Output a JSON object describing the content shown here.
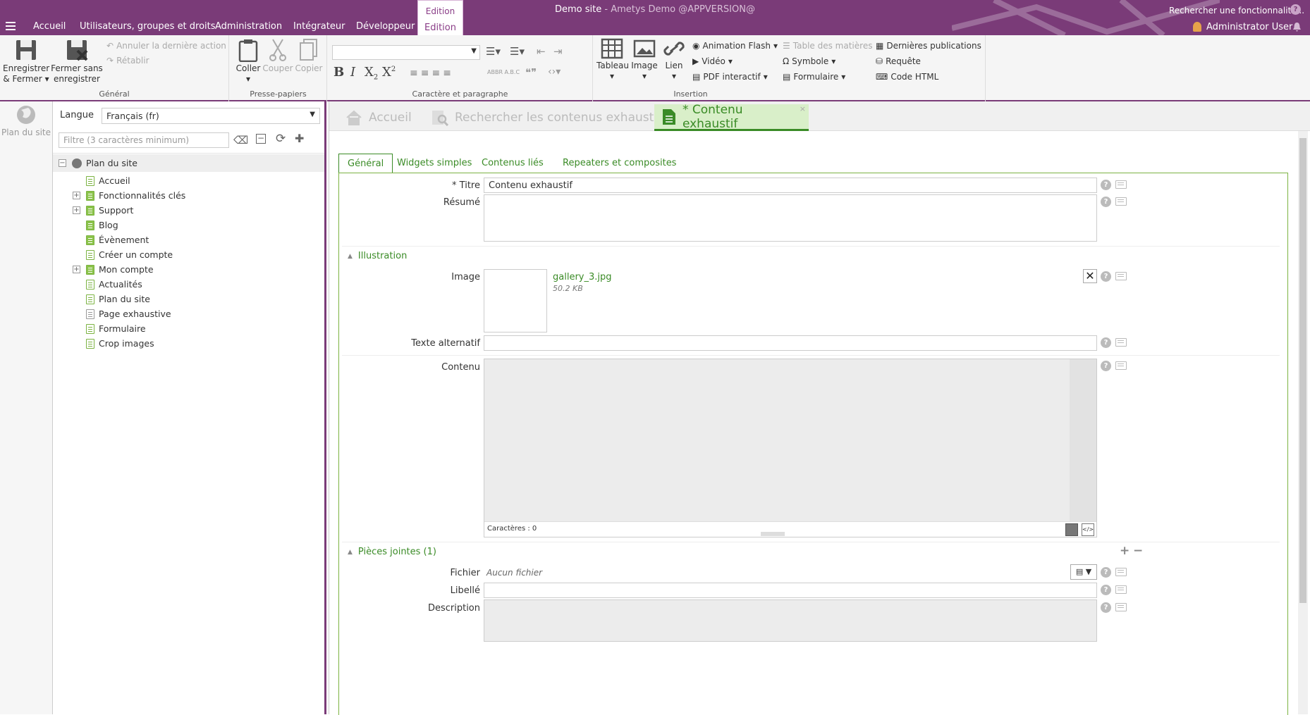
{
  "colors": {
    "brand": "#7a3b78",
    "accent_green": "#3a8b26",
    "ribbon_bg": "#f5f5f5"
  },
  "topbar": {
    "site_name": "Demo site",
    "site_sub": "- Ametys Demo @APPVERSION@",
    "menu": [
      "Accueil",
      "Utilisateurs, groupes et droits",
      "Administration",
      "Intégrateur",
      "Développeur"
    ],
    "context_group": "Edition",
    "context_tab": "Edition",
    "search_placeholder": "Rechercher une fonctionnalité...",
    "user": "Administrator User"
  },
  "ribbon": {
    "general": {
      "label": "Général",
      "save_close": "Enregistrer & Fermer",
      "close_nosave": "Fermer sans enregistrer",
      "undo": "Annuler la dernière action",
      "redo": "Rétablir"
    },
    "clipboard": {
      "label": "Presse-papiers",
      "paste": "Coller",
      "cut": "Couper",
      "copy": "Copier"
    },
    "format": {
      "label": "Caractère et paragraphe"
    },
    "insert": {
      "label": "Insertion",
      "table": "Tableau",
      "image": "Image",
      "link": "Lien",
      "flash": "Animation Flash",
      "video": "Vidéo",
      "pdf": "PDF interactif",
      "toc": "Table des matières",
      "symbol": "Symbole",
      "form": "Formulaire",
      "latest": "Dernières publications",
      "query": "Requête",
      "html": "Code HTML"
    }
  },
  "sidebar": {
    "sitemap_label": "Plan du site"
  },
  "tree": {
    "lang_label": "Langue",
    "lang_value": "Français (fr)",
    "filter_placeholder": "Filtre (3 caractères minimum)",
    "root": "Plan du site",
    "items": [
      {
        "label": "Accueil",
        "exp": false,
        "style": "outline"
      },
      {
        "label": "Fonctionnalités clés",
        "exp": true,
        "style": "fill"
      },
      {
        "label": "Support",
        "exp": true,
        "style": "fill"
      },
      {
        "label": "Blog",
        "exp": false,
        "style": "fill"
      },
      {
        "label": "Évènement",
        "exp": false,
        "style": "fill"
      },
      {
        "label": "Créer un compte",
        "exp": false,
        "style": "outline"
      },
      {
        "label": "Mon compte",
        "exp": true,
        "style": "fill"
      },
      {
        "label": "Actualités",
        "exp": false,
        "style": "outline"
      },
      {
        "label": "Plan du site",
        "exp": false,
        "style": "outline"
      },
      {
        "label": "Page exhaustive",
        "exp": false,
        "style": "grey"
      },
      {
        "label": "Formulaire",
        "exp": false,
        "style": "outline"
      },
      {
        "label": "Crop images",
        "exp": false,
        "style": "outline"
      }
    ]
  },
  "doctabs": {
    "home": "Accueil",
    "search": "Rechercher les contenus exhaustifs",
    "content": "* Contenu exhaustif"
  },
  "formtabs": [
    "Général",
    "Widgets simples",
    "Contenus liés",
    "Repeaters et composites"
  ],
  "form": {
    "title_label": "* Titre",
    "title_value": "Contenu exhaustif",
    "summary_label": "Résumé",
    "illustration": "Illustration",
    "image_label": "Image",
    "image_name": "gallery_3.jpg",
    "image_size": "50.2 KB",
    "alt_label": "Texte alternatif",
    "content_label": "Contenu",
    "char_count": "Caractères : 0",
    "attachments": "Pièces jointes (1)",
    "file_label": "Fichier",
    "file_value": "Aucun fichier",
    "caption_label": "Libellé",
    "desc_label": "Description"
  }
}
